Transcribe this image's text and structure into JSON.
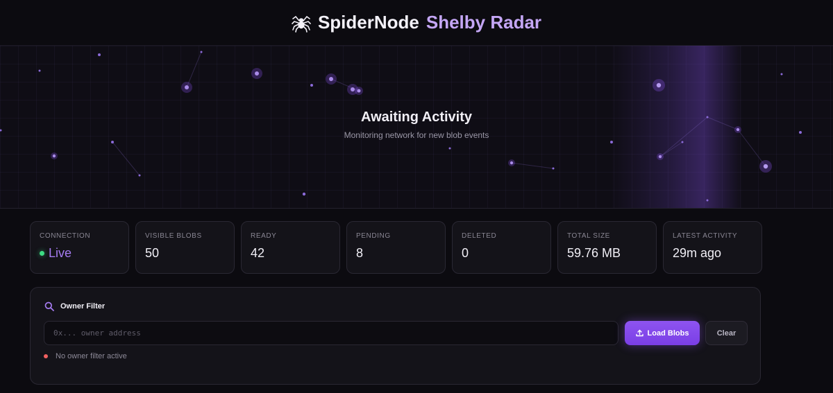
{
  "header": {
    "title_part1": "SpiderNode",
    "title_part2": "Shelby Radar",
    "icon": "spider-icon"
  },
  "radar": {
    "title": "Awaiting Activity",
    "subtitle": "Monitoring network for new blob events"
  },
  "stats": [
    {
      "label": "Connection",
      "value": "Live",
      "status_color": "#3ddc84"
    },
    {
      "label": "Visible Blobs",
      "value": "50"
    },
    {
      "label": "Ready",
      "value": "42"
    },
    {
      "label": "Pending",
      "value": "8"
    },
    {
      "label": "Deleted",
      "value": "0"
    },
    {
      "label": "Total Size",
      "value": "59.76 MB"
    },
    {
      "label": "Latest Activity",
      "value": "29m ago"
    }
  ],
  "filter": {
    "title": "Owner Filter",
    "input_value": "",
    "input_placeholder": "0x... owner address",
    "load_label": "Load Blobs",
    "clear_label": "Clear",
    "status_text": "No owner filter active"
  },
  "colors": {
    "accent": "#8b52f0",
    "accent_light": "#c4a6f5",
    "status_live": "#3ddc84",
    "status_inactive": "#f06060"
  }
}
